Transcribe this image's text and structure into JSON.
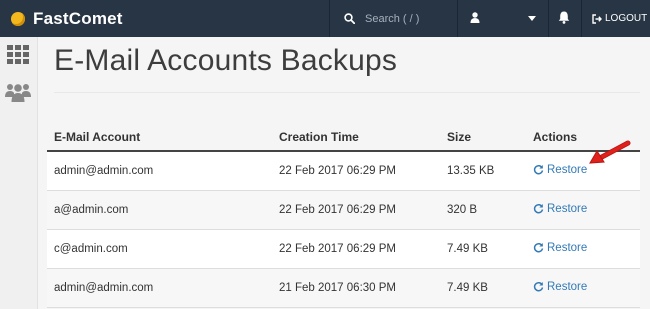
{
  "brand": {
    "name": "FastComet"
  },
  "topbar": {
    "search_placeholder": "Search ( / )",
    "logout_label": "LOGOUT"
  },
  "page": {
    "title": "E-Mail Accounts Backups"
  },
  "table": {
    "headers": [
      "E-Mail Account",
      "Creation Time",
      "Size",
      "Actions"
    ],
    "rows": [
      {
        "account": "admin@admin.com",
        "time": "22 Feb 2017 06:29 PM",
        "size": "13.35 KB",
        "action": "Restore"
      },
      {
        "account": "a@admin.com",
        "time": "22 Feb 2017 06:29 PM",
        "size": "320 B",
        "action": "Restore"
      },
      {
        "account": "c@admin.com",
        "time": "22 Feb 2017 06:29 PM",
        "size": "7.49 KB",
        "action": "Restore"
      },
      {
        "account": "admin@admin.com",
        "time": "21 Feb 2017 06:30 PM",
        "size": "7.49 KB",
        "action": "Restore"
      }
    ]
  },
  "icons": {
    "search": "search-icon",
    "user": "user-icon",
    "bell": "bell-icon",
    "logout": "logout-icon",
    "grid": "grid-icon",
    "users": "users-icon",
    "restore": "refresh-icon",
    "arrow": "red-arrow-annotation"
  },
  "colors": {
    "topbar": "#283545",
    "link": "#337ab7",
    "annotation": "#e0201b",
    "logo": "#f2b81d"
  }
}
